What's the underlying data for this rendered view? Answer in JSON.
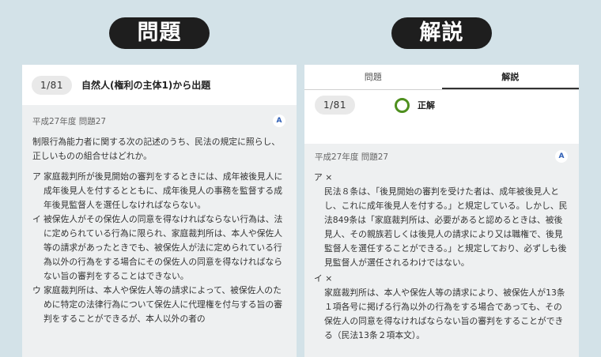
{
  "labels": {
    "left": "問題",
    "right": "解説"
  },
  "question_panel": {
    "count": "1/81",
    "title": "自然人(権利の主体1)から出題",
    "meta": "平成27年度 問題27",
    "badge": "A",
    "question": "制限行為能力者に関する次の記述のうち、民法の規定に照らし、正しいものの組合せはどれか。",
    "options": [
      {
        "mark": "ア",
        "text": "家庭裁判所が後見開始の審判をするときには、成年被後見人に成年後見人を付するとともに、成年後見人の事務を監督する成年後見監督人を選任しなければならない。"
      },
      {
        "mark": "イ",
        "text": "被保佐人がその保佐人の同意を得なければならない行為は、法に定められている行為に限られ、家庭裁判所は、本人や保佐人等の請求があったときでも、被保佐人が法に定められている行為以外の行為をする場合にその保佐人の同意を得なければならない旨の審判をすることはできない。"
      },
      {
        "mark": "ウ",
        "text": "家庭裁判所は、本人や保佐人等の請求によって、被保佐人のために特定の法律行為について保佐人に代理権を付与する旨の審判をすることができるが、本人以外の者の"
      }
    ]
  },
  "answer_panel": {
    "tabs": [
      {
        "label": "問題"
      },
      {
        "label": "解説"
      }
    ],
    "count": "1/81",
    "result": "正解",
    "meta": "平成27年度 問題27",
    "badge": "A",
    "sections": [
      {
        "mark": "ア ×",
        "text": "民法８条は、「後見開始の審判を受けた者は、成年被後見人とし、これに成年後見人を付する。」と規定している。しかし、民法849条は「家庭裁判所は、必要があると認めるときは、被後見人、その親族若しくは後見人の請求により又は職権で、後見監督人を選任することができる。」と規定しており、必ずしも後見監督人が選任されるわけではない。"
      },
      {
        "mark": "イ ×",
        "text": "家庭裁判所は、本人や保佐人等の請求により、被保佐人が13条１項各号に掲げる行為以外の行為をする場合であっても、その保佐人の同意を得なければならない旨の審判をすることができる（民法13条２項本文）。"
      }
    ]
  }
}
